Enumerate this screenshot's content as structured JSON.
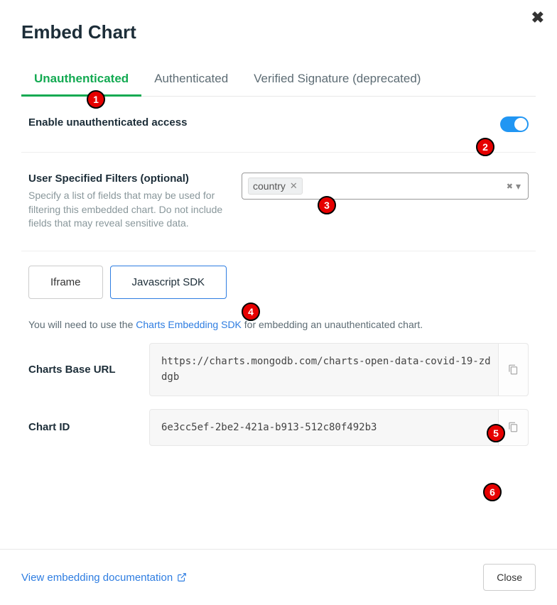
{
  "title": "Embed Chart",
  "close_x": "✖",
  "tabs": {
    "unauthenticated": "Unauthenticated",
    "authenticated": "Authenticated",
    "verified": "Verified Signature (deprecated)"
  },
  "enable_row": {
    "label": "Enable unauthenticated access"
  },
  "filters": {
    "label": "User Specified Filters (optional)",
    "desc": "Specify a list of fields that may be used for filtering this embedded chart. Do not include fields that may reveal sensitive data.",
    "chip": "country",
    "chip_remove": "✕",
    "clear_icon": "✖",
    "caret": "▾"
  },
  "subtabs": {
    "iframe": "Iframe",
    "jssdk": "Javascript SDK"
  },
  "note": {
    "prefix": "You will need to use the ",
    "link": "Charts Embedding SDK",
    "suffix": " for embedding an unauthenticated chart."
  },
  "base_url": {
    "label": "Charts Base URL",
    "value": "https://charts.mongodb.com/charts-open-data-covid-19-zddgb"
  },
  "chart_id": {
    "label": "Chart ID",
    "value": "6e3cc5ef-2be2-421a-b913-512c80f492b3"
  },
  "footer": {
    "doc_link": "View embedding documentation",
    "external_icon": "↗",
    "close": "Close"
  },
  "markers": {
    "m1": "1",
    "m2": "2",
    "m3": "3",
    "m4": "4",
    "m5": "5",
    "m6": "6"
  }
}
